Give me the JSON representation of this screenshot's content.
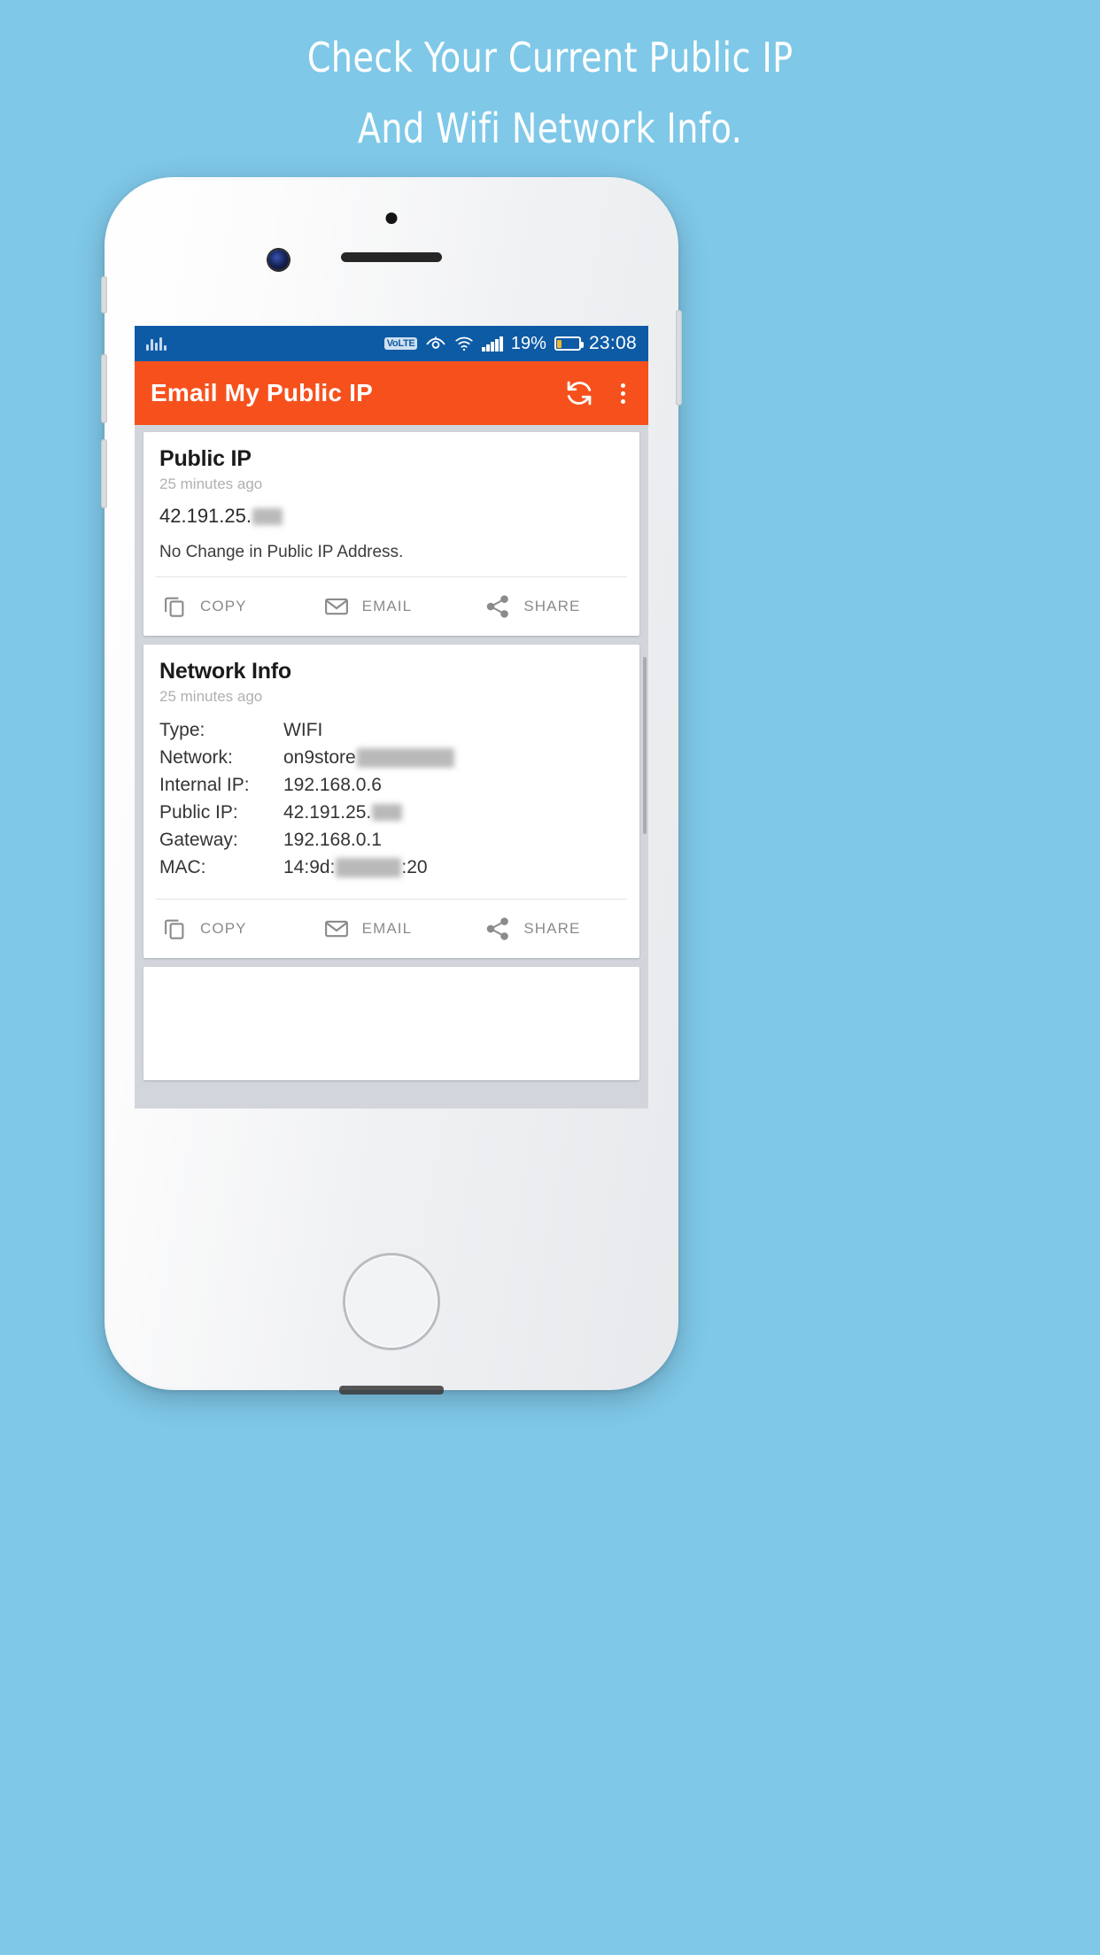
{
  "promo": {
    "line1": "Check Your Current Public IP",
    "line2": "And Wifi Network Info."
  },
  "colors": {
    "background": "#7FC8E8",
    "statusbar": "#0E5BA5",
    "appbar": "#F6511D",
    "battery_fill": "#F5B731",
    "card": "#FFFFFF",
    "screen_bg": "#D2D6DC"
  },
  "statusbar": {
    "equalizer_icon": "equalizer-icon",
    "volte_label": "VoLTE",
    "eye_comfort_icon": "eye-comfort-icon",
    "wifi_icon": "wifi-icon",
    "signal_icon": "signal-bars-icon",
    "battery_percent": "19%",
    "battery_icon": "battery-icon",
    "clock": "23:08"
  },
  "appbar": {
    "title": "Email My Public IP",
    "refresh_icon": "refresh-icon",
    "overflow_icon": "overflow-menu-icon"
  },
  "cards": [
    {
      "id": "public-ip",
      "title": "Public IP",
      "subtitle": "25 minutes ago",
      "value_prefix": "42.191.25.",
      "value_redacted": true,
      "status_message": "No Change in Public IP Address.",
      "actions": [
        {
          "icon": "copy-icon",
          "label": "COPY"
        },
        {
          "icon": "email-icon",
          "label": "EMAIL"
        },
        {
          "icon": "share-icon",
          "label": "SHARE"
        }
      ]
    },
    {
      "id": "network-info",
      "title": "Network Info",
      "subtitle": "25 minutes ago",
      "rows": [
        {
          "key": "Type:",
          "value": "WIFI",
          "redacted": "none"
        },
        {
          "key": "Network:",
          "value": "on9store",
          "redacted": "after"
        },
        {
          "key": "Internal IP:",
          "value": "192.168.0.6",
          "redacted": "none"
        },
        {
          "key": "Public IP:",
          "value": "42.191.25.",
          "redacted": "after-sm"
        },
        {
          "key": "Gateway:",
          "value": "192.168.0.1",
          "redacted": "none"
        },
        {
          "key": "MAC:",
          "value": "14:9d:",
          "redacted": "middle",
          "value_suffix": ":20"
        }
      ],
      "actions": [
        {
          "icon": "copy-icon",
          "label": "COPY"
        },
        {
          "icon": "email-icon",
          "label": "EMAIL"
        },
        {
          "icon": "share-icon",
          "label": "SHARE"
        }
      ]
    },
    {
      "id": "ad-placeholder",
      "title": "",
      "subtitle": ""
    }
  ]
}
